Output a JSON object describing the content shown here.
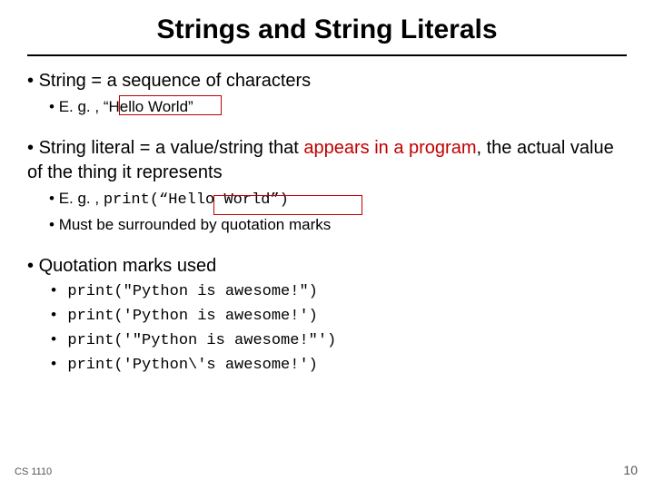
{
  "title": "Strings and String Literals",
  "bullets": {
    "a": {
      "text": "String = a sequence of characters",
      "sub1_prefix": "E. g. ,   ",
      "sub1_literal": "“Hello World”"
    },
    "b": {
      "prefix": "String literal = a value/string that ",
      "red1": "appears in a program",
      "suffix": ", the actual value of the thing it represents",
      "sub1_prefix": "E. g. ,  ",
      "sub1_code": "print(“Hello World”)",
      "sub2": "Must be surrounded by quotation marks"
    },
    "c": {
      "text": "Quotation marks used",
      "items": [
        "print(\"Python is awesome!\")",
        "print('Python is awesome!')",
        "print('\"Python is awesome!\"')",
        "print('Python\\'s awesome!')"
      ]
    }
  },
  "footer": {
    "course": "CS 1110",
    "page": "10"
  }
}
